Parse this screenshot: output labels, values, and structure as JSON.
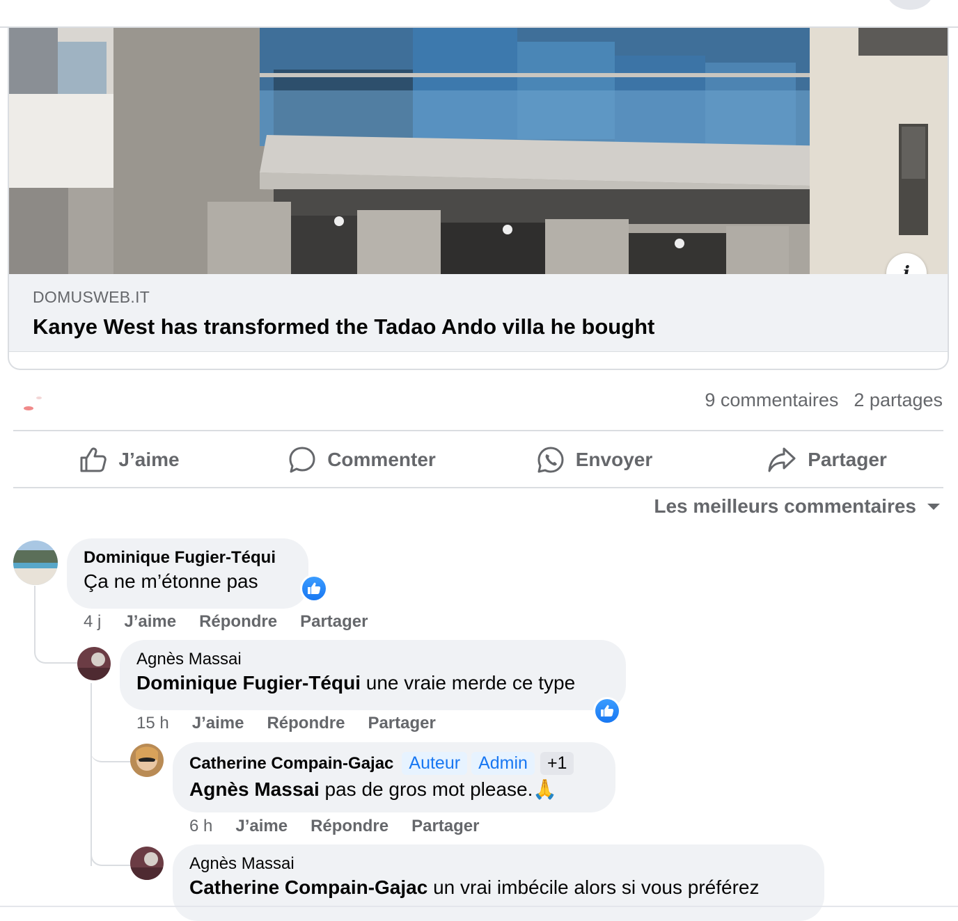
{
  "link_preview": {
    "domain": "DOMUSWEB.IT",
    "title": "Kanye West has transformed the Tadao Ando villa he bought",
    "info_icon": "info-icon"
  },
  "stats": {
    "comments": "9 commentaires",
    "shares": "2 partages"
  },
  "actions": {
    "like": "J’aime",
    "comment": "Commenter",
    "send": "Envoyer",
    "share": "Partager"
  },
  "sort": {
    "label": "Les meilleurs commentaires"
  },
  "comments": [
    {
      "author": "Dominique Fugier-Téqui",
      "text": "Ça ne m’étonne pas",
      "time": "4 j",
      "like": "J’aime",
      "reply": "Répondre",
      "share": "Partager"
    },
    {
      "author": "Agnès Massai",
      "mention": "Dominique Fugier-Téqui",
      "text": " une vraie merde ce type",
      "time": "15 h",
      "like": "J’aime",
      "reply": "Répondre",
      "share": "Partager"
    },
    {
      "author": "Catherine Compain-Gajac",
      "badges": [
        "Auteur",
        "Admin",
        "+1"
      ],
      "mention": "Agnès Massai",
      "text": " pas de gros mot please.🙏",
      "time": "6 h",
      "like": "J’aime",
      "reply": "Répondre",
      "share": "Partager"
    },
    {
      "author": "Agnès Massai",
      "mention": "Catherine Compain-Gajac",
      "text": " un vrai imbécile alors si vous préférez"
    }
  ],
  "colors": {
    "accent": "#1877f2",
    "secondary_text": "#65676b",
    "bubble": "#f0f2f5"
  }
}
